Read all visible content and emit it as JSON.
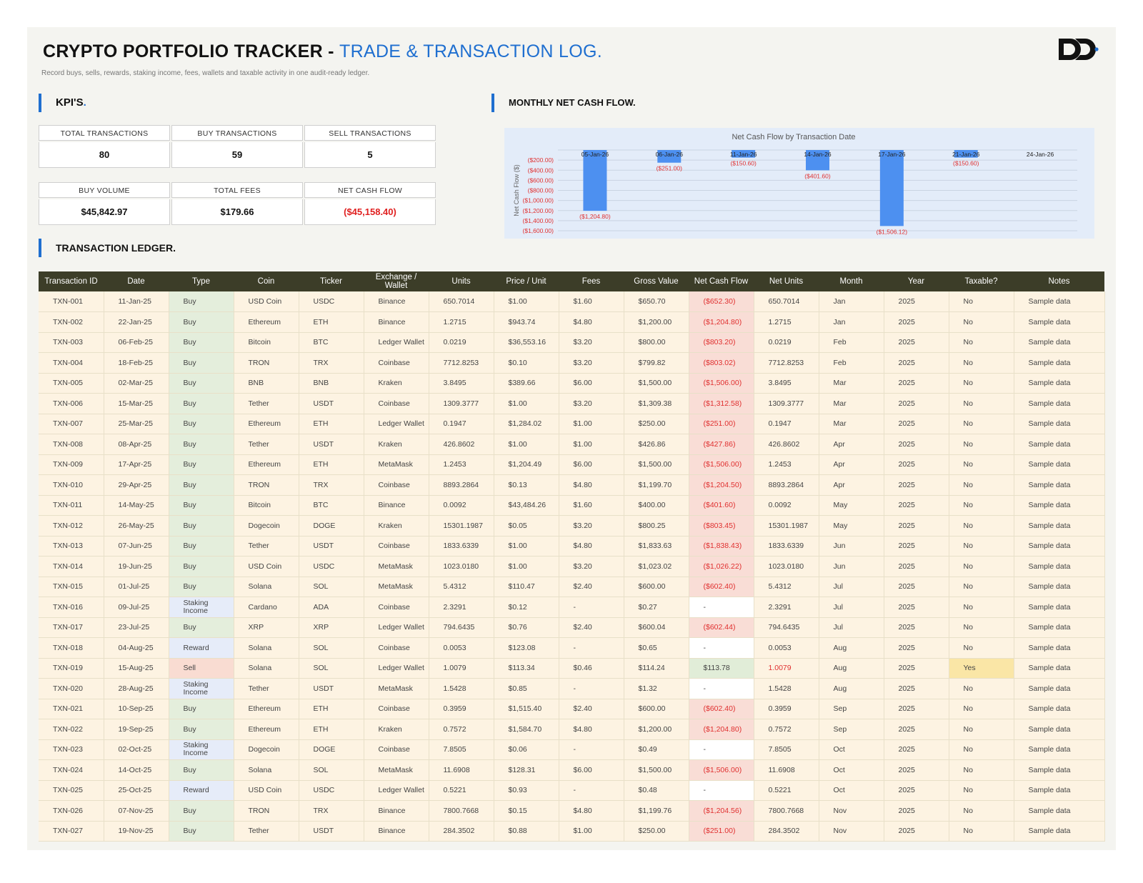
{
  "header": {
    "title": "CRYPTO PORTFOLIO TRACKER - ",
    "title_accent": "TRADE & TRANSACTION LOG.",
    "subtitle": "Record buys, sells, rewards, staking income, fees, wallets and taxable activity in one audit-ready ledger.",
    "logo_icon": "dd-logo-icon"
  },
  "sections": {
    "kpis": "KPI'S",
    "kpis_dot": ".",
    "monthly": "MONTHLY NET CASH FLOW.",
    "ledger": "TRANSACTION LEDGER."
  },
  "kpis": {
    "total_transactions": {
      "label": "TOTAL TRANSACTIONS",
      "value": "80"
    },
    "buy_transactions": {
      "label": "BUY TRANSACTIONS",
      "value": "59"
    },
    "sell_transactions": {
      "label": "SELL TRANSACTIONS",
      "value": "5"
    },
    "buy_volume": {
      "label": "BUY VOLUME",
      "value": "$45,842.97"
    },
    "total_fees": {
      "label": "TOTAL FEES",
      "value": "$179.66"
    },
    "net_cash_flow": {
      "label": "NET CASH FLOW",
      "value": "($45,158.40)"
    }
  },
  "chart_data": {
    "type": "bar",
    "title": "Net Cash Flow by Transaction Date",
    "xlabel": "",
    "ylabel": "Net Cash Flow ($)",
    "categories": [
      "05-Jan-26",
      "06-Jan-26",
      "11-Jan-26",
      "14-Jan-26",
      "17-Jan-26",
      "21-Jan-26",
      "24-Jan-26"
    ],
    "values": [
      -1204.8,
      -251.0,
      -150.6,
      -401.6,
      -1506.12,
      -150.6,
      0
    ],
    "data_labels": [
      "($1,204.80)",
      "($251.00)",
      "($150.60)",
      "($401.60)",
      "($1,506.12)",
      "($150.60)",
      ""
    ],
    "yticks": [
      -200,
      -400,
      -600,
      -800,
      -1000,
      -1200,
      -1400,
      -1600
    ],
    "ytick_labels": [
      "($200.00)",
      "($400.00)",
      "($600.00)",
      "($800.00)",
      "($1,000.00)",
      "($1,200.00)",
      "($1,400.00)",
      "($1,600.00)"
    ],
    "ylim": [
      -1600,
      0
    ],
    "grid": true,
    "bar_color": "#4d90f0",
    "label_color": "#e03030"
  },
  "table": {
    "columns": [
      "Transaction ID",
      "Date",
      "Type",
      "Coin",
      "Ticker",
      "Exchange / Wallet",
      "Units",
      "Price / Unit",
      "Fees",
      "Gross Value",
      "Net Cash Flow",
      "Net Units",
      "Month",
      "Year",
      "Taxable?",
      "Notes"
    ],
    "rows": [
      [
        "TXN-001",
        "11-Jan-25",
        "Buy",
        "USD Coin",
        "USDC",
        "Binance",
        "650.7014",
        "$1.00",
        "$1.60",
        "$650.70",
        "($652.30)",
        "650.7014",
        "Jan",
        "2025",
        "No",
        "Sample data"
      ],
      [
        "TXN-002",
        "22-Jan-25",
        "Buy",
        "Ethereum",
        "ETH",
        "Binance",
        "1.2715",
        "$943.74",
        "$4.80",
        "$1,200.00",
        "($1,204.80)",
        "1.2715",
        "Jan",
        "2025",
        "No",
        "Sample data"
      ],
      [
        "TXN-003",
        "06-Feb-25",
        "Buy",
        "Bitcoin",
        "BTC",
        "Ledger Wallet",
        "0.0219",
        "$36,553.16",
        "$3.20",
        "$800.00",
        "($803.20)",
        "0.0219",
        "Feb",
        "2025",
        "No",
        "Sample data"
      ],
      [
        "TXN-004",
        "18-Feb-25",
        "Buy",
        "TRON",
        "TRX",
        "Coinbase",
        "7712.8253",
        "$0.10",
        "$3.20",
        "$799.82",
        "($803.02)",
        "7712.8253",
        "Feb",
        "2025",
        "No",
        "Sample data"
      ],
      [
        "TXN-005",
        "02-Mar-25",
        "Buy",
        "BNB",
        "BNB",
        "Kraken",
        "3.8495",
        "$389.66",
        "$6.00",
        "$1,500.00",
        "($1,506.00)",
        "3.8495",
        "Mar",
        "2025",
        "No",
        "Sample data"
      ],
      [
        "TXN-006",
        "15-Mar-25",
        "Buy",
        "Tether",
        "USDT",
        "Coinbase",
        "1309.3777",
        "$1.00",
        "$3.20",
        "$1,309.38",
        "($1,312.58)",
        "1309.3777",
        "Mar",
        "2025",
        "No",
        "Sample data"
      ],
      [
        "TXN-007",
        "25-Mar-25",
        "Buy",
        "Ethereum",
        "ETH",
        "Ledger Wallet",
        "0.1947",
        "$1,284.02",
        "$1.00",
        "$250.00",
        "($251.00)",
        "0.1947",
        "Mar",
        "2025",
        "No",
        "Sample data"
      ],
      [
        "TXN-008",
        "08-Apr-25",
        "Buy",
        "Tether",
        "USDT",
        "Kraken",
        "426.8602",
        "$1.00",
        "$1.00",
        "$426.86",
        "($427.86)",
        "426.8602",
        "Apr",
        "2025",
        "No",
        "Sample data"
      ],
      [
        "TXN-009",
        "17-Apr-25",
        "Buy",
        "Ethereum",
        "ETH",
        "MetaMask",
        "1.2453",
        "$1,204.49",
        "$6.00",
        "$1,500.00",
        "($1,506.00)",
        "1.2453",
        "Apr",
        "2025",
        "No",
        "Sample data"
      ],
      [
        "TXN-010",
        "29-Apr-25",
        "Buy",
        "TRON",
        "TRX",
        "Coinbase",
        "8893.2864",
        "$0.13",
        "$4.80",
        "$1,199.70",
        "($1,204.50)",
        "8893.2864",
        "Apr",
        "2025",
        "No",
        "Sample data"
      ],
      [
        "TXN-011",
        "14-May-25",
        "Buy",
        "Bitcoin",
        "BTC",
        "Binance",
        "0.0092",
        "$43,484.26",
        "$1.60",
        "$400.00",
        "($401.60)",
        "0.0092",
        "May",
        "2025",
        "No",
        "Sample data"
      ],
      [
        "TXN-012",
        "26-May-25",
        "Buy",
        "Dogecoin",
        "DOGE",
        "Kraken",
        "15301.1987",
        "$0.05",
        "$3.20",
        "$800.25",
        "($803.45)",
        "15301.1987",
        "May",
        "2025",
        "No",
        "Sample data"
      ],
      [
        "TXN-013",
        "07-Jun-25",
        "Buy",
        "Tether",
        "USDT",
        "Coinbase",
        "1833.6339",
        "$1.00",
        "$4.80",
        "$1,833.63",
        "($1,838.43)",
        "1833.6339",
        "Jun",
        "2025",
        "No",
        "Sample data"
      ],
      [
        "TXN-014",
        "19-Jun-25",
        "Buy",
        "USD Coin",
        "USDC",
        "MetaMask",
        "1023.0180",
        "$1.00",
        "$3.20",
        "$1,023.02",
        "($1,026.22)",
        "1023.0180",
        "Jun",
        "2025",
        "No",
        "Sample data"
      ],
      [
        "TXN-015",
        "01-Jul-25",
        "Buy",
        "Solana",
        "SOL",
        "MetaMask",
        "5.4312",
        "$110.47",
        "$2.40",
        "$600.00",
        "($602.40)",
        "5.4312",
        "Jul",
        "2025",
        "No",
        "Sample data"
      ],
      [
        "TXN-016",
        "09-Jul-25",
        "Staking Income",
        "Cardano",
        "ADA",
        "Coinbase",
        "2.3291",
        "$0.12",
        "-",
        "$0.27",
        "-",
        "2.3291",
        "Jul",
        "2025",
        "No",
        "Sample data"
      ],
      [
        "TXN-017",
        "23-Jul-25",
        "Buy",
        "XRP",
        "XRP",
        "Ledger Wallet",
        "794.6435",
        "$0.76",
        "$2.40",
        "$600.04",
        "($602.44)",
        "794.6435",
        "Jul",
        "2025",
        "No",
        "Sample data"
      ],
      [
        "TXN-018",
        "04-Aug-25",
        "Reward",
        "Solana",
        "SOL",
        "Coinbase",
        "0.0053",
        "$123.08",
        "-",
        "$0.65",
        "-",
        "0.0053",
        "Aug",
        "2025",
        "No",
        "Sample data"
      ],
      [
        "TXN-019",
        "15-Aug-25",
        "Sell",
        "Solana",
        "SOL",
        "Ledger Wallet",
        "1.0079",
        "$113.34",
        "$0.46",
        "$114.24",
        "$113.78",
        "1.0079",
        "Aug",
        "2025",
        "Yes",
        "Sample data"
      ],
      [
        "TXN-020",
        "28-Aug-25",
        "Staking Income",
        "Tether",
        "USDT",
        "MetaMask",
        "1.5428",
        "$0.85",
        "-",
        "$1.32",
        "-",
        "1.5428",
        "Aug",
        "2025",
        "No",
        "Sample data"
      ],
      [
        "TXN-021",
        "10-Sep-25",
        "Buy",
        "Ethereum",
        "ETH",
        "Coinbase",
        "0.3959",
        "$1,515.40",
        "$2.40",
        "$600.00",
        "($602.40)",
        "0.3959",
        "Sep",
        "2025",
        "No",
        "Sample data"
      ],
      [
        "TXN-022",
        "19-Sep-25",
        "Buy",
        "Ethereum",
        "ETH",
        "Kraken",
        "0.7572",
        "$1,584.70",
        "$4.80",
        "$1,200.00",
        "($1,204.80)",
        "0.7572",
        "Sep",
        "2025",
        "No",
        "Sample data"
      ],
      [
        "TXN-023",
        "02-Oct-25",
        "Staking Income",
        "Dogecoin",
        "DOGE",
        "Coinbase",
        "7.8505",
        "$0.06",
        "-",
        "$0.49",
        "-",
        "7.8505",
        "Oct",
        "2025",
        "No",
        "Sample data"
      ],
      [
        "TXN-024",
        "14-Oct-25",
        "Buy",
        "Solana",
        "SOL",
        "MetaMask",
        "11.6908",
        "$128.31",
        "$6.00",
        "$1,500.00",
        "($1,506.00)",
        "11.6908",
        "Oct",
        "2025",
        "No",
        "Sample data"
      ],
      [
        "TXN-025",
        "25-Oct-25",
        "Reward",
        "USD Coin",
        "USDC",
        "Ledger Wallet",
        "0.5221",
        "$0.93",
        "-",
        "$0.48",
        "-",
        "0.5221",
        "Oct",
        "2025",
        "No",
        "Sample data"
      ],
      [
        "TXN-026",
        "07-Nov-25",
        "Buy",
        "TRON",
        "TRX",
        "Binance",
        "7800.7668",
        "$0.15",
        "$4.80",
        "$1,199.76",
        "($1,204.56)",
        "7800.7668",
        "Nov",
        "2025",
        "No",
        "Sample data"
      ],
      [
        "TXN-027",
        "19-Nov-25",
        "Buy",
        "Tether",
        "USDT",
        "Binance",
        "284.3502",
        "$0.88",
        "$1.00",
        "$250.00",
        "($251.00)",
        "284.3502",
        "Nov",
        "2025",
        "No",
        "Sample data"
      ]
    ]
  }
}
